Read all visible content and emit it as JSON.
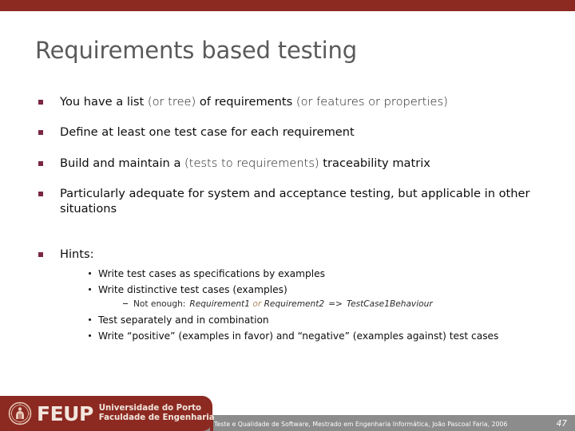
{
  "slide": {
    "title": "Requirements based testing",
    "page_number": "47",
    "accent_color": "#8C2A22",
    "title_color": "#5a5a5a",
    "bullet_color": "#7B2742",
    "footer_bar_color": "#8C8C8C",
    "highlight_color": "#B08A63"
  },
  "bullets": [
    {
      "pre": "You have a list ",
      "paren1": "(or tree)",
      "mid": " of requirements ",
      "paren2": "(or features or properties)"
    },
    {
      "text": "Define at least one test case for each requirement"
    },
    {
      "pre": "Build and maintain a ",
      "paren1": "(tests to requirements)",
      "mid": " traceability matrix"
    },
    {
      "text": "Particularly adequate for system and acceptance testing, but applicable in other situations"
    }
  ],
  "hints": {
    "label": "Hints:",
    "items": [
      {
        "text": "Write test cases as specifications by examples"
      },
      {
        "text": "Write distinctive test cases (examples)"
      },
      {
        "text": "Test separately and in combination"
      },
      {
        "text": "Write “positive” (examples in favor) and “negative” (examples against) test cases"
      }
    ],
    "sub_note": {
      "lead": "Not enough:",
      "req1": "Requirement1",
      "conjunction": "or",
      "req2": "Requirement2",
      "arrow": "=>",
      "result": "TestCase1Behaviour"
    }
  },
  "footer": {
    "text": "Teste e Qualidade de Software, Mestrado em Engenharia Informática, João Pascoal Faria, 2006",
    "page_number": "47"
  },
  "logo": {
    "acronym": "FEUP",
    "line1": "Universidade do Porto",
    "line2": "Faculdade de Engenharia"
  }
}
